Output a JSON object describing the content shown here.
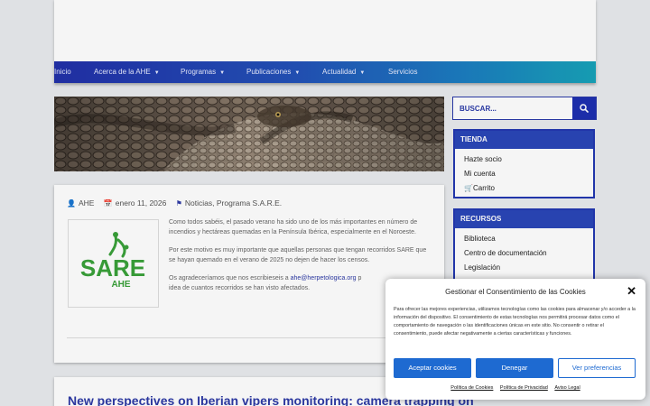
{
  "nav": {
    "items": [
      {
        "label": "Inicio",
        "dropdown": false
      },
      {
        "label": "Acerca de la AHE",
        "dropdown": true
      },
      {
        "label": "Programas",
        "dropdown": true
      },
      {
        "label": "Publicaciones",
        "dropdown": true
      },
      {
        "label": "Actualidad",
        "dropdown": true
      },
      {
        "label": "Servicios",
        "dropdown": false
      }
    ]
  },
  "post": {
    "author": "AHE",
    "date": "enero 11, 2026",
    "categories": "Noticias, Programa S.A.R.E.",
    "logo_text_main": "SARE",
    "logo_text_sub": "AHE",
    "paragraph1": "Como todos sabéis, el pasado verano ha sido uno de los más importantes en número de incendios y hectáreas quemadas en la Península Ibérica, especialmente en el Noroeste.",
    "paragraph2": "Por este motivo es muy importante que aquellas personas que tengan recorridos SARE que se hayan quemado en el verano de 2025 no dejen de hacer los censos.",
    "paragraph3_start": "Os agradeceríamos que nos escribieseis a ",
    "paragraph3_email": "ahe@herpetologica.org",
    "paragraph3_end": " p",
    "paragraph3_line2": "idea de cuantos recorridos se han visto afectados."
  },
  "post2": {
    "title": "New perspectives on Iberian vipers monitoring: camera trapping on"
  },
  "sidebar": {
    "search_placeholder": "BUSCAR...",
    "tienda": {
      "title": "TIENDA",
      "items": [
        "Hazte socio",
        "Mi cuenta",
        "Carrito"
      ]
    },
    "recursos": {
      "title": "RECURSOS",
      "items": [
        "Biblioteca",
        "Centro de documentación",
        "Legislación"
      ]
    }
  },
  "cookie": {
    "title": "Gestionar el Consentimiento de las Cookies",
    "text": "Para ofrecer las mejores experiencias, utilizamos tecnologías como las cookies para almacenar y/o acceder a la información del dispositivo. El consentimiento de estas tecnologías nos permitirá procesar datos como el comportamiento de navegación o las identificaciones únicas en este sitio. No consentir o retirar el consentimiento, puede afectar negativamente a ciertas características y funciones.",
    "accept": "Aceptar cookies",
    "deny": "Denegar",
    "preferences": "Ver preferencias",
    "links": [
      "Política de Cookies",
      "Política de Privacidad",
      "Aviso Legal"
    ]
  },
  "colors": {
    "brand_blue": "#2d3aa5",
    "logo_green": "#3aa13a",
    "cookie_blue": "#1e6ad1"
  }
}
